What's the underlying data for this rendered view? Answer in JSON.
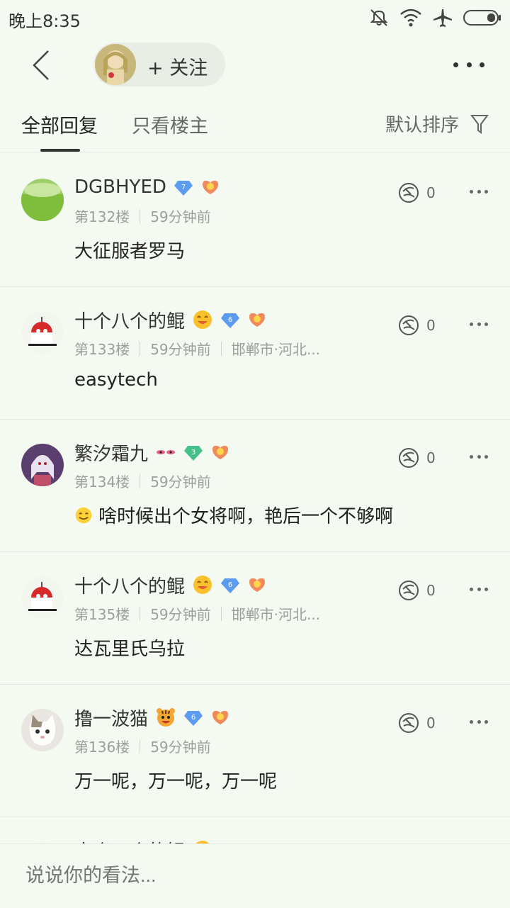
{
  "status_bar": {
    "time": "晚上8:35"
  },
  "header": {
    "follow_label": "+ 关注"
  },
  "tabs": {
    "all": "全部回复",
    "owner_only": "只看楼主",
    "sort": "默认排序"
  },
  "posts": [
    {
      "username": "DGBHYED",
      "level": "7",
      "floor": "第132楼",
      "time": "59分钟前",
      "location": "",
      "content": "大征服者罗马",
      "likes": "0"
    },
    {
      "username": "十个八个的鲲",
      "level": "6",
      "floor": "第133楼",
      "time": "59分钟前",
      "location": "邯郸市·河北...",
      "content": "easytech",
      "likes": "0"
    },
    {
      "username": "繁汐霜九",
      "level": "3",
      "floor": "第134楼",
      "time": "59分钟前",
      "location": "",
      "content": "啥时候出个女将啊，艳后一个不够啊",
      "likes": "0"
    },
    {
      "username": "十个八个的鲲",
      "level": "6",
      "floor": "第135楼",
      "time": "59分钟前",
      "location": "邯郸市·河北...",
      "content": "达瓦里氏乌拉",
      "likes": "0"
    },
    {
      "username": "撸一波猫",
      "level": "6",
      "floor": "第136楼",
      "time": "59分钟前",
      "location": "",
      "content": "万一呢，万一呢，万一呢",
      "likes": "0"
    },
    {
      "username": "十个八个的鲲",
      "level": "6",
      "floor": "",
      "time": "",
      "location": "",
      "content": "",
      "likes": ""
    }
  ],
  "comment_box": {
    "placeholder": "说说你的看法..."
  },
  "colors": {
    "background": "#f4f9f2",
    "diamond_blue": "#5b9bf0",
    "diamond_green": "#46c08a",
    "badge_orange": "#f08a5d"
  }
}
